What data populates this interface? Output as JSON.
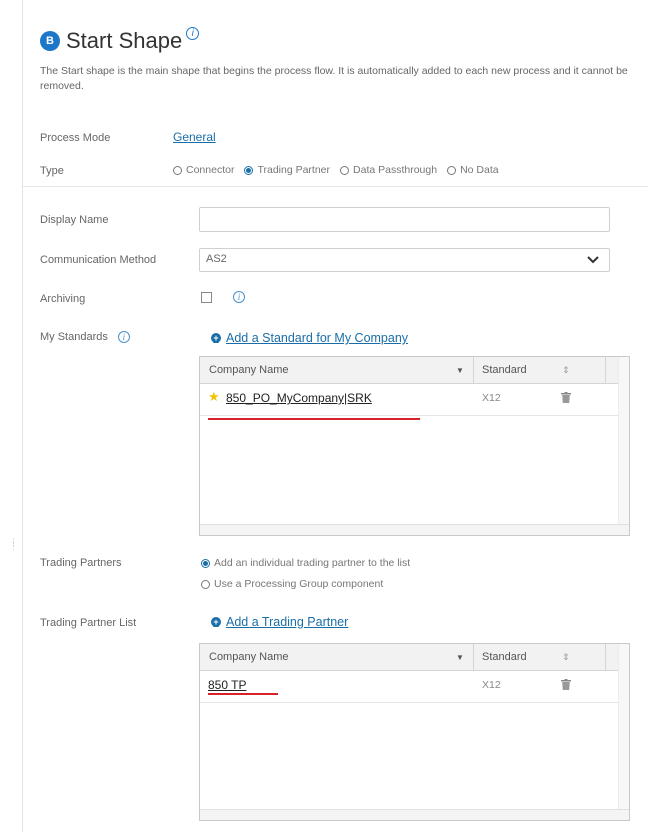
{
  "header": {
    "title": "Start Shape",
    "description": "The Start shape is the main shape that begins the process flow. It is automatically added to each new process and it cannot be removed."
  },
  "process_mode": {
    "label": "Process Mode",
    "value": "General"
  },
  "type": {
    "label": "Type",
    "options": [
      "Connector",
      "Trading Partner",
      "Data Passthrough",
      "No Data"
    ],
    "selected": "Trading Partner"
  },
  "display_name": {
    "label": "Display Name",
    "value": "",
    "placeholder": ""
  },
  "communication_method": {
    "label": "Communication Method",
    "value": "AS2"
  },
  "archiving": {
    "label": "Archiving",
    "checked": false
  },
  "my_standards": {
    "label": "My Standards",
    "add_link": "Add a Standard for My Company",
    "columns": [
      "Company Name",
      "Standard"
    ],
    "rows": [
      {
        "name": "850_PO_MyCompany|SRK",
        "standard": "X12",
        "default": true
      }
    ]
  },
  "trading_partners": {
    "label": "Trading Partners",
    "options": [
      "Add an individual trading partner to the list",
      "Use a Processing Group component"
    ],
    "selected": "Add an individual trading partner to the list"
  },
  "trading_partner_list": {
    "label": "Trading Partner List",
    "add_link": "Add a Trading Partner",
    "columns": [
      "Company Name",
      "Standard"
    ],
    "rows": [
      {
        "name": "850 TP",
        "standard": "X12"
      }
    ]
  },
  "colors": {
    "link": "#1a6ea8",
    "accent": "#1d77c9",
    "highlight": "#d7212b",
    "star": "#f5c400"
  },
  "icons": {
    "logo": "B",
    "info": "i",
    "add": "+",
    "sort_down": "▼",
    "sort": "⇕",
    "trash": "trash-icon",
    "star": "★",
    "dropdown": "chevron-down-icon"
  }
}
